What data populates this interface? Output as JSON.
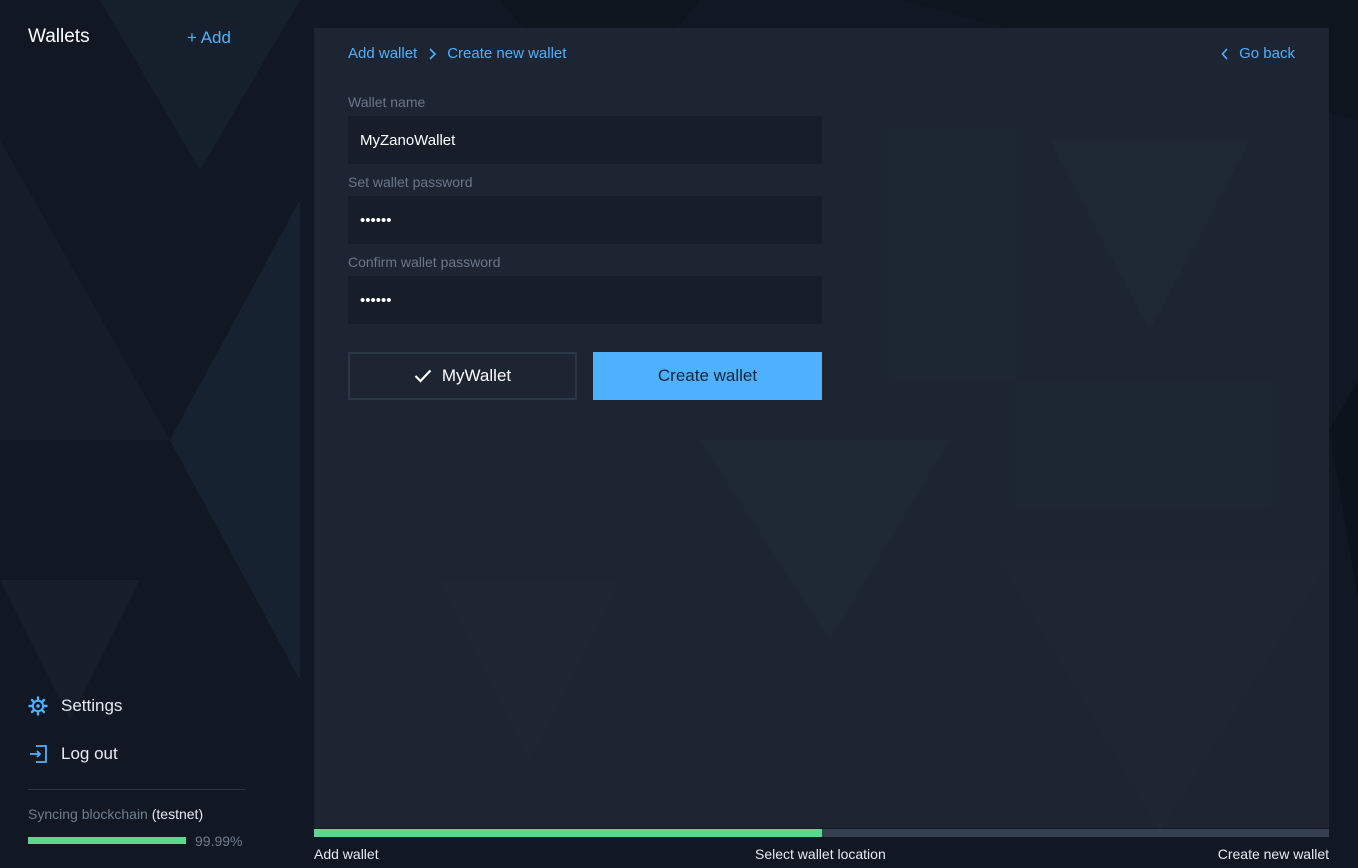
{
  "sidebar": {
    "title": "Wallets",
    "add_label": "+ Add",
    "menu": [
      {
        "label": "Settings",
        "icon": "gear-icon"
      },
      {
        "label": "Log out",
        "icon": "logout-icon"
      }
    ],
    "sync": {
      "text": "Syncing blockchain",
      "network": "(testnet)",
      "percent_label": "99.99%",
      "percent": 99.99
    }
  },
  "main": {
    "breadcrumb": [
      "Add wallet",
      "Create new wallet"
    ],
    "go_back": "Go back",
    "fields": {
      "wallet_name": {
        "label": "Wallet name",
        "value": "MyZanoWallet"
      },
      "password": {
        "label": "Set wallet password",
        "value": "••••••"
      },
      "confirm": {
        "label": "Confirm wallet password",
        "value": "••••••"
      }
    },
    "select_button": "MyWallet",
    "create_button": "Create wallet"
  },
  "steps": {
    "labels": [
      "Add wallet",
      "Select wallet location",
      "Create new wallet"
    ],
    "progress": 0.5
  },
  "colors": {
    "accent": "#4db1ff",
    "success": "#5bd88e",
    "background": "#111823",
    "panel": "#1e2734"
  }
}
